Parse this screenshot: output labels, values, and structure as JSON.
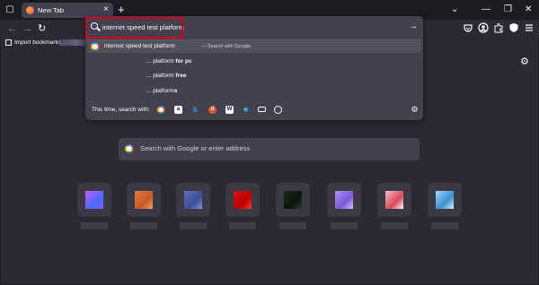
{
  "tabs": [
    {
      "label": "New Tab",
      "close_glyph": "×"
    }
  ],
  "tabstrip": {
    "new_tab_glyph": "+",
    "menu_glyph": "☰",
    "list_glyph": "⌄",
    "minimize_glyph": "—",
    "maximize_glyph": "❐",
    "close_glyph": "✕"
  },
  "toolbar": {
    "back_glyph": "←",
    "forward_glyph": "→",
    "reload_glyph": "↻"
  },
  "bookmarks": {
    "import_label": "Import bookmarks..."
  },
  "urlbar": {
    "value": "internet speed test platform",
    "go_glyph": "→",
    "suggestions": [
      {
        "prefix": "internet speed test platform",
        "bold": "",
        "action": "— Search with Google"
      },
      {
        "prefix": "... platform ",
        "bold": "for pc",
        "action": ""
      },
      {
        "prefix": "... platform ",
        "bold": "free",
        "action": ""
      },
      {
        "prefix": "... platform",
        "bold": "s",
        "action": ""
      }
    ],
    "one_off_label": "This time, search with:",
    "engines": [
      "google",
      "amazon",
      "bing",
      "duckduckgo",
      "wikipedia",
      "bookmarks",
      "tabs",
      "history"
    ]
  },
  "newtab": {
    "settings_glyph": "⚙",
    "search_placeholder": "Search with Google or enter address"
  },
  "colors": {
    "accent_red": "#d70022",
    "bg": "#2b2a33",
    "panel": "#42414d"
  }
}
